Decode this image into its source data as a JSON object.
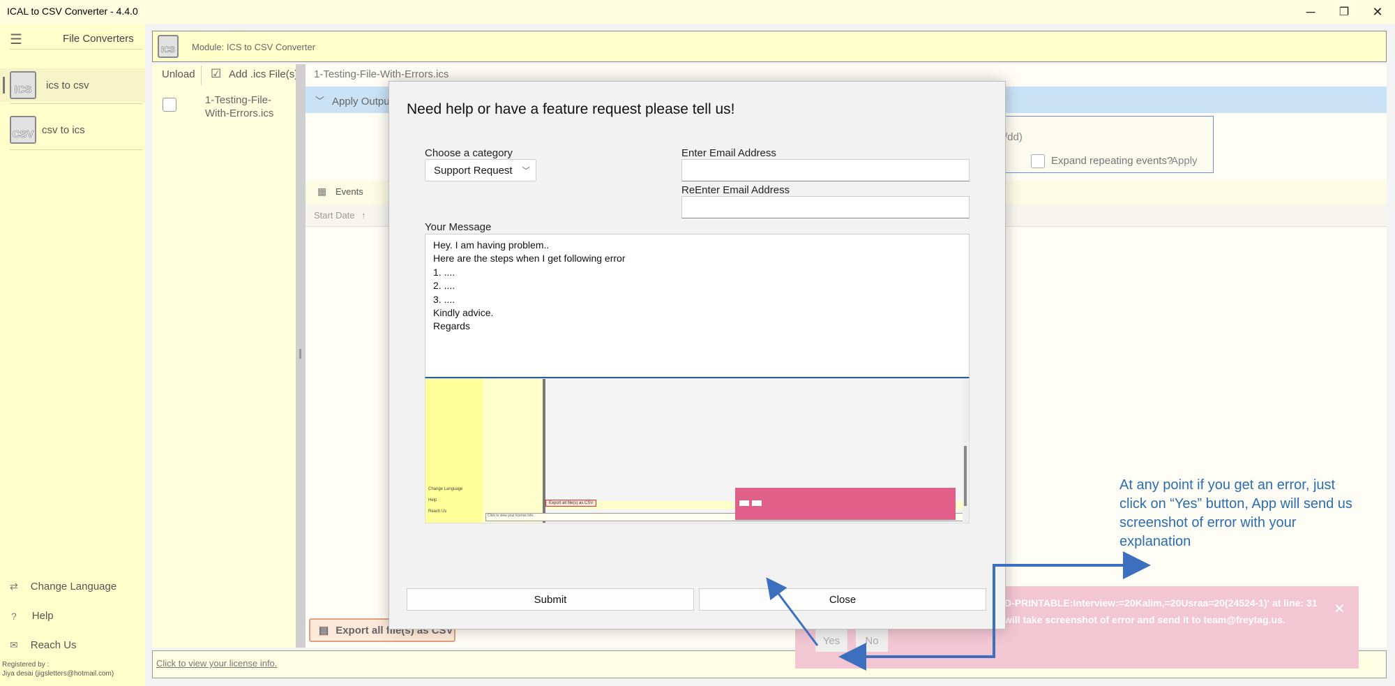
{
  "app": {
    "title": "ICAL to CSV Converter -  4.4.0",
    "window_controls": {
      "minimize": "─",
      "restore": "❐",
      "close": "✕"
    }
  },
  "sidebar": {
    "menu_icon": "hamburger-icon",
    "title": "File Converters",
    "items": [
      {
        "label": "ics to csv",
        "badge": "ICS",
        "selected": true
      },
      {
        "label": "csv to ics",
        "badge": "CSV",
        "selected": false
      }
    ],
    "bottom": [
      {
        "label": "Change Language",
        "icon": "language-icon",
        "glyph": "⇄"
      },
      {
        "label": "Help",
        "icon": "question-icon",
        "glyph": "?"
      },
      {
        "label": "Reach Us",
        "icon": "mail-icon",
        "glyph": "✉"
      }
    ],
    "registered_label": "Registered by :",
    "registered_user": "Jiya desai (jigsletters@hotmail.com)"
  },
  "module": {
    "badge": "ICS",
    "title": "Module: ICS to CSV Converter"
  },
  "file_panel": {
    "unload_label": "Unload",
    "add_label": "Add .ics File(s):",
    "file_name": "1-Testing-File-\nWith-Errors.ics"
  },
  "content": {
    "filename": "1-Testing-File-With-Errors.ics",
    "apply_output_label": "Apply Output",
    "date_fragment": "/dd)",
    "expand_label": "Expand repeating events?",
    "apply_button": "Apply",
    "events_tab": "Events",
    "start_date_col": "Start Date",
    "export_button": "Export all file(s) as CSV"
  },
  "license": {
    "link": "Click to view your license info."
  },
  "toast": {
    "line1": "D-PRINTABLE:Interview:=20Kalim,=20Usraa=20(24524-1)' at line: 31",
    "line2": "will take screenshot of error and send it to team@freytag.us.",
    "yes": "Yes",
    "no": "No",
    "accent": "#f3c6d3"
  },
  "dialog": {
    "title": "Need help or have a feature request please tell us!",
    "category_label": "Choose a category",
    "category_value": "Support Request",
    "email_label": "Enter Email Address",
    "email_value": "",
    "reemail_label": "ReEnter Email Address",
    "reemail_value": "",
    "message_label": "Your Message",
    "message_text": "Hey. I am having problem..\nHere are the steps when I get following error\n1. ....\n2. ....\n3. ....\nKindly advice.\nRegards",
    "submit": "Submit",
    "close": "Close",
    "screenshot": {
      "menu": [
        "Change Language",
        "Help",
        "Reach Us"
      ],
      "export": "Export all file(s) as CSV",
      "license": "Click to view your license info."
    }
  },
  "annotation": {
    "text": "At any point if you get an error, just click on “Yes” button, App will send us screenshot of error with your explanation",
    "color": "#2c6cb0"
  }
}
